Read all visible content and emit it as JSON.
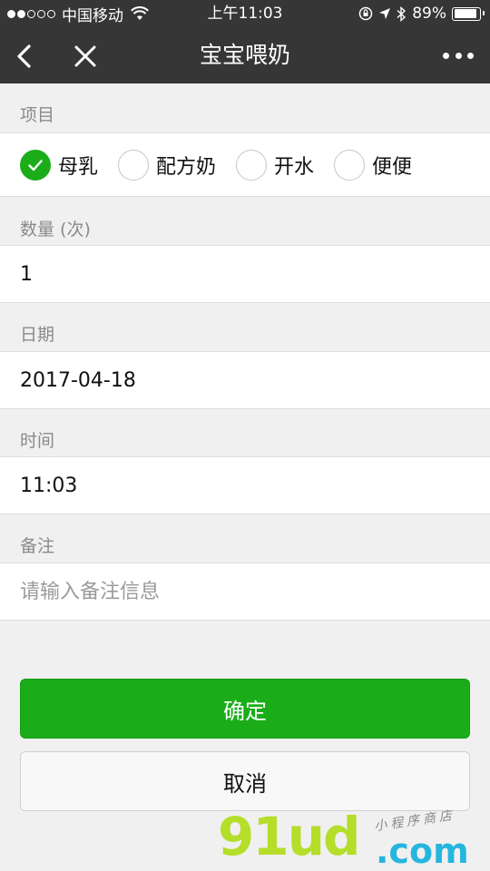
{
  "status_bar": {
    "carrier": "中国移动",
    "time": "上午11:03",
    "battery_text": "89%",
    "battery_level": 0.89,
    "signal_dots_filled": 2,
    "signal_dots_total": 5,
    "icons": [
      "wifi-icon",
      "orientation-lock-icon",
      "location-arrow-icon",
      "bluetooth-icon",
      "battery-icon"
    ]
  },
  "nav": {
    "title": "宝宝喂奶",
    "icons": [
      "back-chevron-icon",
      "close-icon",
      "more-dots-icon"
    ]
  },
  "form": {
    "item_label": "项目",
    "options": [
      {
        "label": "母乳",
        "checked": true
      },
      {
        "label": "配方奶",
        "checked": false
      },
      {
        "label": "开水",
        "checked": false
      },
      {
        "label": "便便",
        "checked": false
      }
    ],
    "quantity_label": "数量 (次)",
    "quantity_value": "1",
    "date_label": "日期",
    "date_value": "2017-04-18",
    "time_label": "时间",
    "time_value": "11:03",
    "note_label": "备注",
    "note_value": "",
    "note_placeholder": "请输入备注信息"
  },
  "buttons": {
    "confirm": "确定",
    "cancel": "取消"
  },
  "watermark": {
    "main": "91ud",
    "com": ".com",
    "tag": "小程序商店"
  },
  "colors": {
    "nav_bg": "#363636",
    "page_bg": "#f0f0f0",
    "primary_green": "#1aad19",
    "label_gray": "#8a8a8a"
  }
}
